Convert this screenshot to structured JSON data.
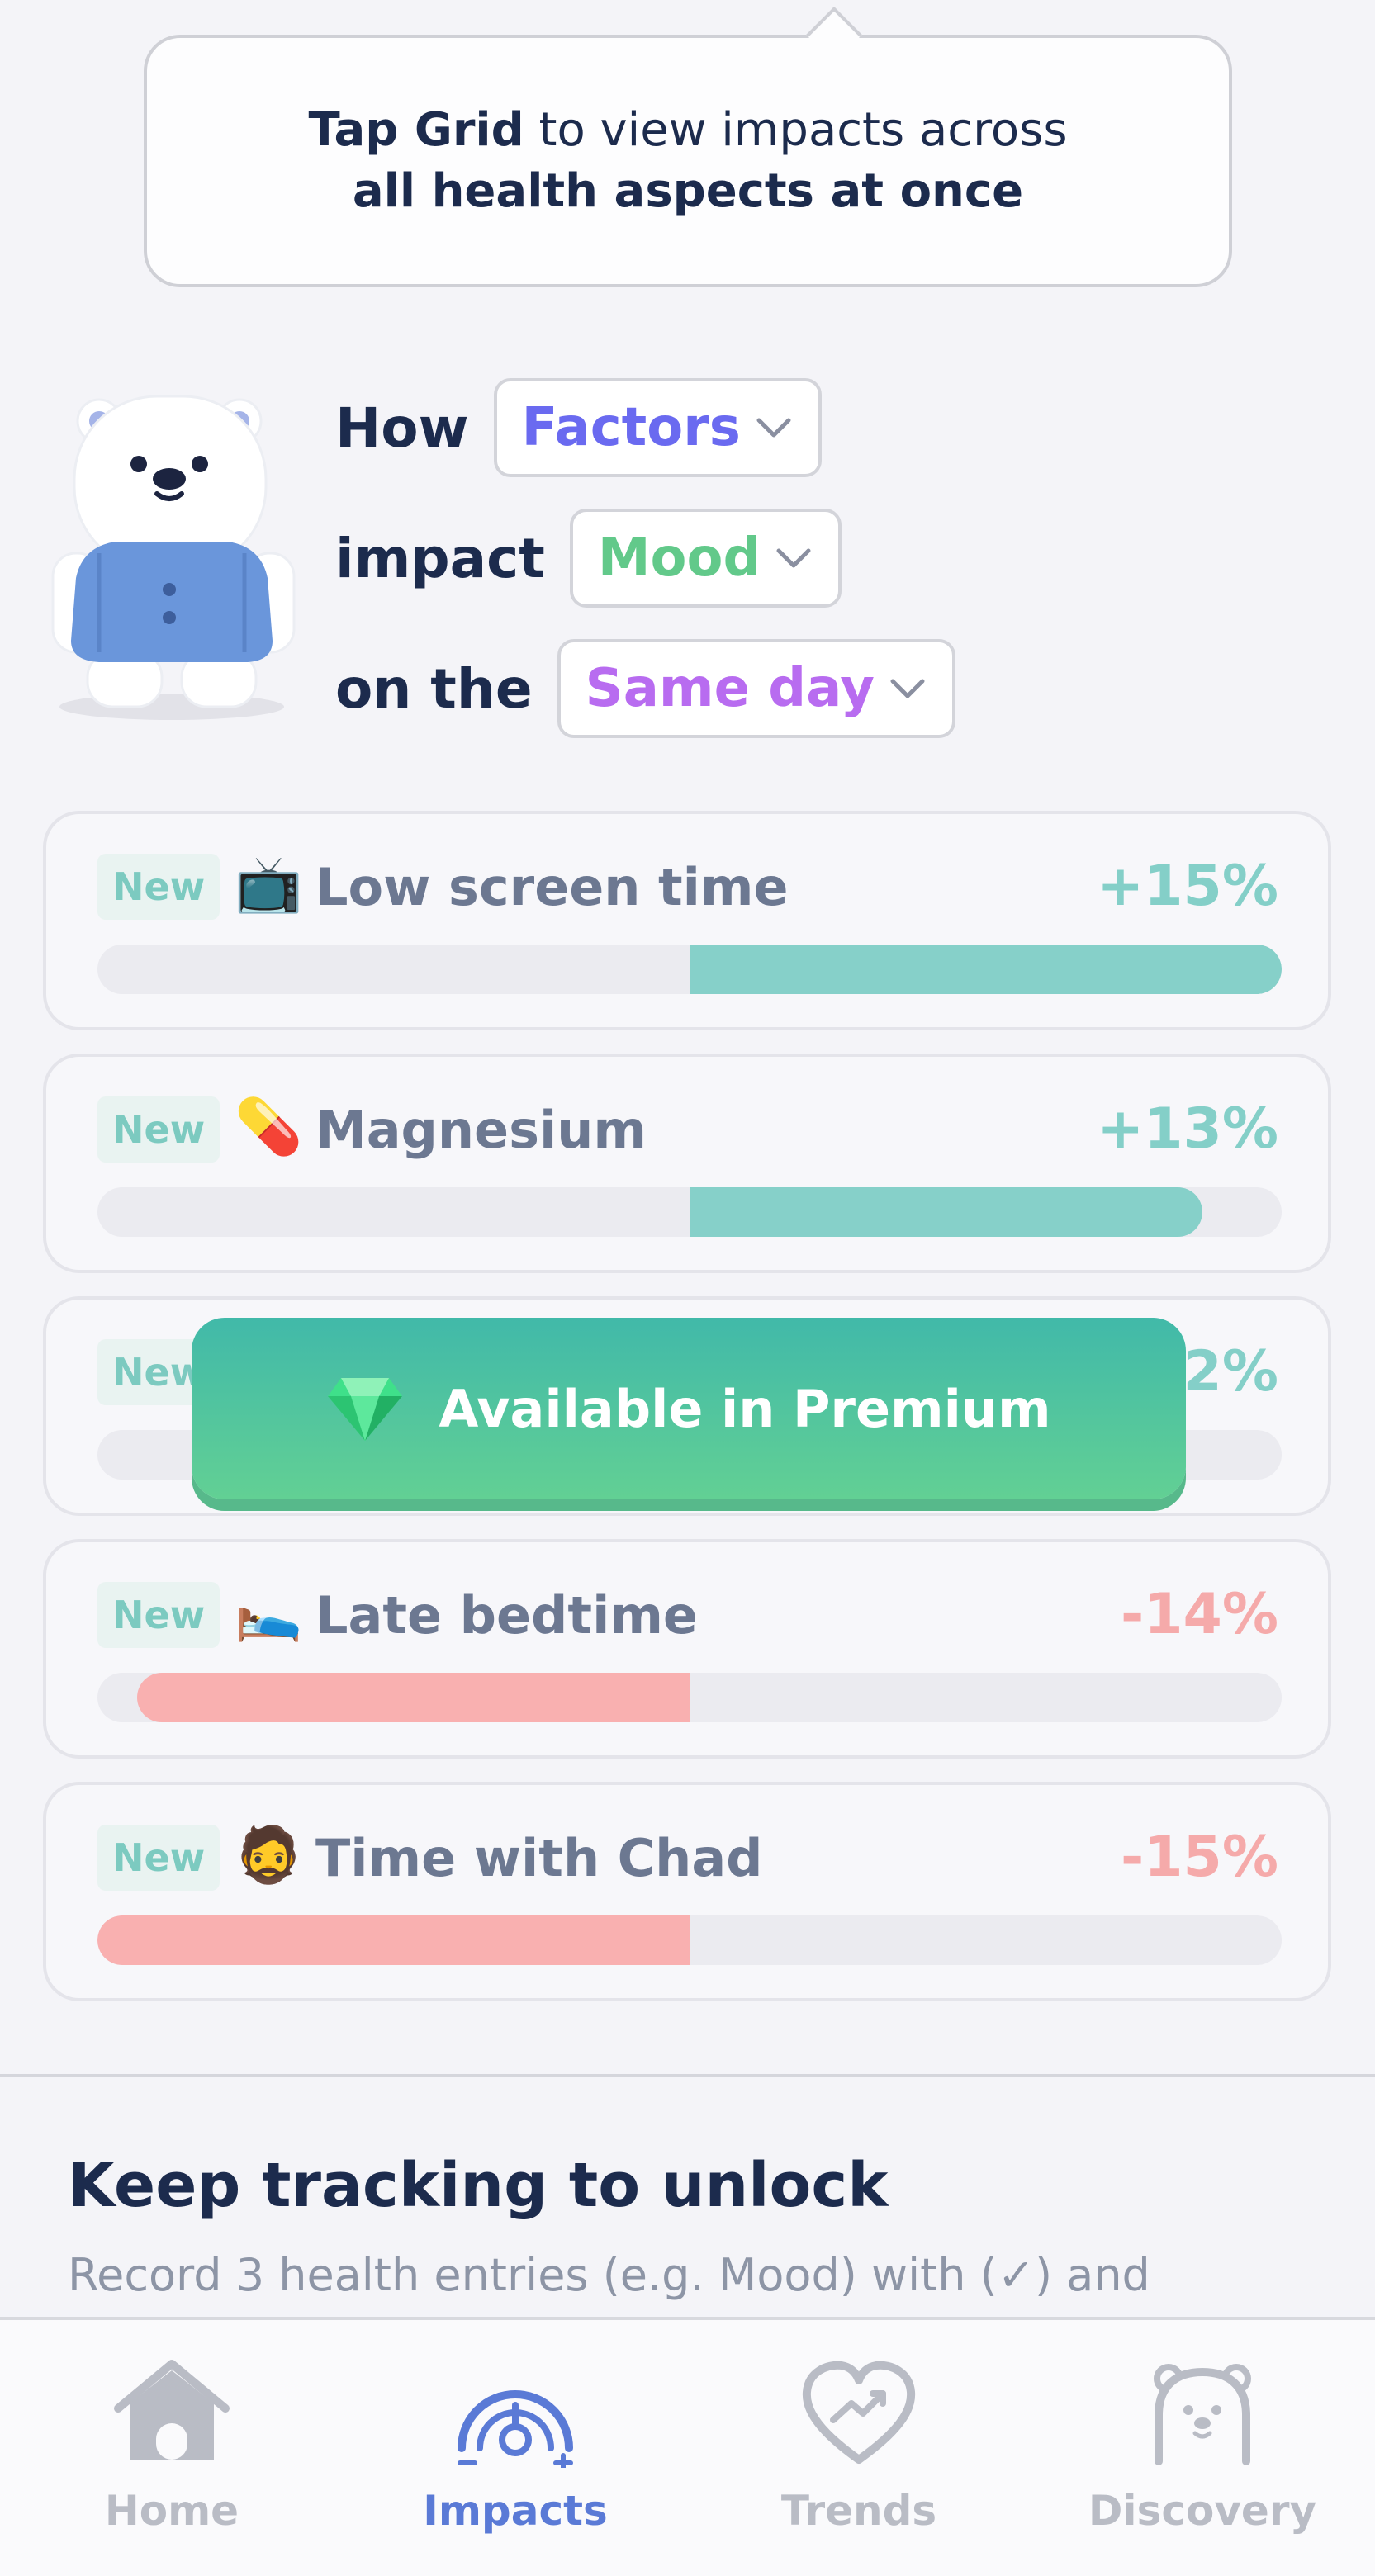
{
  "tooltip": {
    "bold1": "Tap Grid",
    "text1": " to view impacts across",
    "bold2": "all health aspects at once"
  },
  "query": {
    "word_how": "How",
    "factors": "Factors",
    "word_impact": "impact",
    "metric": "Mood",
    "word_on_the": "on the",
    "timing": "Same day",
    "colors": {
      "factors": "#6a6af0",
      "metric": "#62c98a",
      "timing": "#b86cf0"
    }
  },
  "factors": [
    {
      "badge": "New",
      "emoji": "📺",
      "label": "Low screen time",
      "value": "+15%",
      "fraction": 0.15,
      "sign": "pos"
    },
    {
      "badge": "New",
      "emoji": "💊",
      "label": "Magnesium",
      "value": "+13%",
      "fraction": 0.13,
      "sign": "pos"
    },
    {
      "badge": "New",
      "emoji": "",
      "label": "",
      "value": "2%",
      "fraction": 0.0,
      "sign": "pos"
    },
    {
      "badge": "New",
      "emoji": "🛌",
      "label": "Late bedtime",
      "value": "-14%",
      "fraction": 0.14,
      "sign": "neg"
    },
    {
      "badge": "New",
      "emoji": "🧔",
      "label": "Time with Chad",
      "value": "-15%",
      "fraction": 0.15,
      "sign": "neg"
    }
  ],
  "premium": {
    "label": "Available in Premium",
    "icon": "gem-icon"
  },
  "unlock": {
    "title": "Keep tracking to unlock",
    "text": "Record 3 health entries (e.g. Mood) with (✓) and"
  },
  "nav": {
    "items": [
      {
        "label": "Home",
        "icon": "home-icon"
      },
      {
        "label": "Impacts",
        "icon": "impacts-gauge-icon"
      },
      {
        "label": "Trends",
        "icon": "trends-heart-icon"
      },
      {
        "label": "Discovery",
        "icon": "bear-face-icon"
      }
    ],
    "active_color": "#5a7ad6",
    "inactive_color": "#b9bcc5"
  }
}
